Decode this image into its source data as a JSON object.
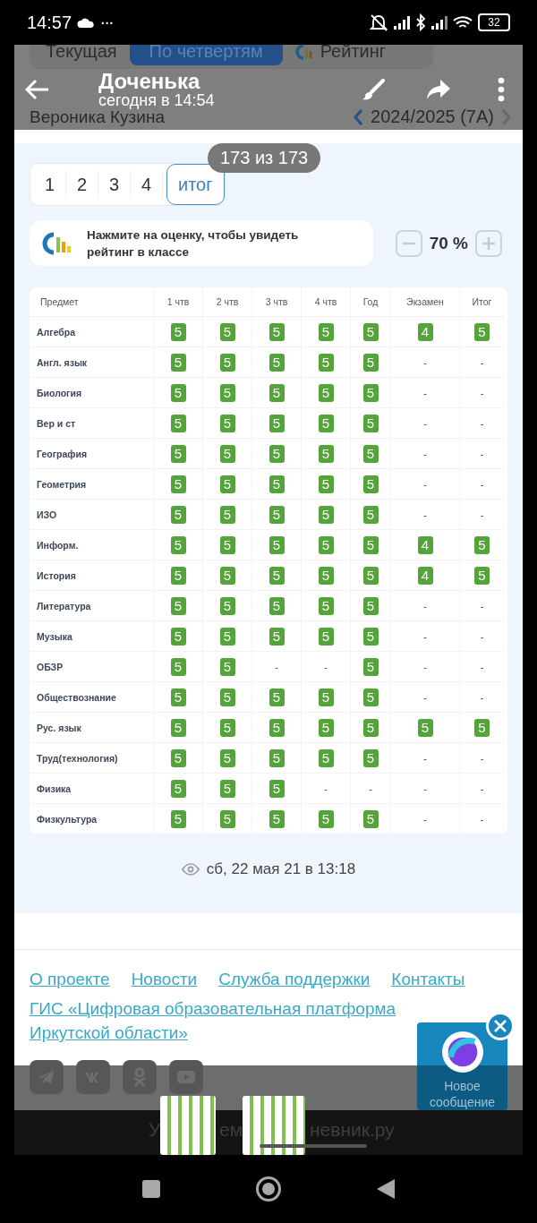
{
  "status_bar": {
    "time": "14:57",
    "more": "···",
    "battery": "32"
  },
  "page_tabs": [
    {
      "label": "Текущая",
      "selected": false
    },
    {
      "label": "По четвертям",
      "selected": true
    },
    {
      "label": "Рейтинг",
      "selected": false
    }
  ],
  "student": {
    "name": "Вероника Кузина",
    "year": "2024/2025 (7А)"
  },
  "viewer": {
    "title": "Доченька",
    "subtitle": "сегодня в 14:54",
    "counter": "173 из 173"
  },
  "quarter_tabs": [
    {
      "label": "1",
      "selected": false
    },
    {
      "label": "2",
      "selected": false
    },
    {
      "label": "3",
      "selected": false
    },
    {
      "label": "4",
      "selected": false
    },
    {
      "label": "итог",
      "selected": true
    }
  ],
  "rating_hint": {
    "text": "Нажмите на оценку, чтобы увидеть рейтинг в классе",
    "zoom": "70 %"
  },
  "table": {
    "columns": [
      "Предмет",
      "1 чтв",
      "2 чтв",
      "3 чтв",
      "4 чтв",
      "Год",
      "Экзамен",
      "Итог"
    ],
    "rows": [
      {
        "cells": [
          {
            "kind": "subject",
            "text": "Алгебра"
          },
          {
            "kind": "grade",
            "text": "5"
          },
          {
            "kind": "grade",
            "text": "5"
          },
          {
            "kind": "grade",
            "text": "5"
          },
          {
            "kind": "grade",
            "text": "5"
          },
          {
            "kind": "grade",
            "text": "5"
          },
          {
            "kind": "grade",
            "text": "4"
          },
          {
            "kind": "grade",
            "text": "5"
          }
        ]
      },
      {
        "cells": [
          {
            "kind": "subject",
            "text": "Англ. язык"
          },
          {
            "kind": "grade",
            "text": "5"
          },
          {
            "kind": "grade",
            "text": "5"
          },
          {
            "kind": "grade",
            "text": "5"
          },
          {
            "kind": "grade",
            "text": "5"
          },
          {
            "kind": "grade",
            "text": "5"
          },
          {
            "kind": "empty",
            "text": "-"
          },
          {
            "kind": "empty",
            "text": "-"
          }
        ]
      },
      {
        "cells": [
          {
            "kind": "subject",
            "text": "Биология"
          },
          {
            "kind": "grade",
            "text": "5"
          },
          {
            "kind": "grade",
            "text": "5"
          },
          {
            "kind": "grade",
            "text": "5"
          },
          {
            "kind": "grade",
            "text": "5"
          },
          {
            "kind": "grade",
            "text": "5"
          },
          {
            "kind": "empty",
            "text": "-"
          },
          {
            "kind": "empty",
            "text": "-"
          }
        ]
      },
      {
        "cells": [
          {
            "kind": "subject",
            "text": "Вер и ст"
          },
          {
            "kind": "grade",
            "text": "5"
          },
          {
            "kind": "grade",
            "text": "5"
          },
          {
            "kind": "grade",
            "text": "5"
          },
          {
            "kind": "grade",
            "text": "5"
          },
          {
            "kind": "grade",
            "text": "5"
          },
          {
            "kind": "empty",
            "text": "-"
          },
          {
            "kind": "empty",
            "text": "-"
          }
        ]
      },
      {
        "cells": [
          {
            "kind": "subject",
            "text": "География"
          },
          {
            "kind": "grade",
            "text": "5"
          },
          {
            "kind": "grade",
            "text": "5"
          },
          {
            "kind": "grade",
            "text": "5"
          },
          {
            "kind": "grade",
            "text": "5"
          },
          {
            "kind": "grade",
            "text": "5"
          },
          {
            "kind": "empty",
            "text": "-"
          },
          {
            "kind": "empty",
            "text": "-"
          }
        ]
      },
      {
        "cells": [
          {
            "kind": "subject",
            "text": "Геометрия"
          },
          {
            "kind": "grade",
            "text": "5"
          },
          {
            "kind": "grade",
            "text": "5"
          },
          {
            "kind": "grade",
            "text": "5"
          },
          {
            "kind": "grade",
            "text": "5"
          },
          {
            "kind": "grade",
            "text": "5"
          },
          {
            "kind": "empty",
            "text": "-"
          },
          {
            "kind": "empty",
            "text": "-"
          }
        ]
      },
      {
        "cells": [
          {
            "kind": "subject",
            "text": "ИЗО"
          },
          {
            "kind": "grade",
            "text": "5"
          },
          {
            "kind": "grade",
            "text": "5"
          },
          {
            "kind": "grade",
            "text": "5"
          },
          {
            "kind": "grade",
            "text": "5"
          },
          {
            "kind": "grade",
            "text": "5"
          },
          {
            "kind": "empty",
            "text": "-"
          },
          {
            "kind": "empty",
            "text": "-"
          }
        ]
      },
      {
        "cells": [
          {
            "kind": "subject",
            "text": "Информ."
          },
          {
            "kind": "grade",
            "text": "5"
          },
          {
            "kind": "grade",
            "text": "5"
          },
          {
            "kind": "grade",
            "text": "5"
          },
          {
            "kind": "grade",
            "text": "5"
          },
          {
            "kind": "grade",
            "text": "5"
          },
          {
            "kind": "grade",
            "text": "4"
          },
          {
            "kind": "grade",
            "text": "5"
          }
        ]
      },
      {
        "cells": [
          {
            "kind": "subject",
            "text": "История"
          },
          {
            "kind": "grade",
            "text": "5"
          },
          {
            "kind": "grade",
            "text": "5"
          },
          {
            "kind": "grade",
            "text": "5"
          },
          {
            "kind": "grade",
            "text": "5"
          },
          {
            "kind": "grade",
            "text": "5"
          },
          {
            "kind": "grade",
            "text": "4"
          },
          {
            "kind": "grade",
            "text": "5"
          }
        ]
      },
      {
        "cells": [
          {
            "kind": "subject",
            "text": "Литература"
          },
          {
            "kind": "grade",
            "text": "5"
          },
          {
            "kind": "grade",
            "text": "5"
          },
          {
            "kind": "grade",
            "text": "5"
          },
          {
            "kind": "grade",
            "text": "5"
          },
          {
            "kind": "grade",
            "text": "5"
          },
          {
            "kind": "empty",
            "text": "-"
          },
          {
            "kind": "empty",
            "text": "-"
          }
        ]
      },
      {
        "cells": [
          {
            "kind": "subject",
            "text": "Музыка"
          },
          {
            "kind": "grade",
            "text": "5"
          },
          {
            "kind": "grade",
            "text": "5"
          },
          {
            "kind": "grade",
            "text": "5"
          },
          {
            "kind": "grade",
            "text": "5"
          },
          {
            "kind": "grade",
            "text": "5"
          },
          {
            "kind": "empty",
            "text": "-"
          },
          {
            "kind": "empty",
            "text": "-"
          }
        ]
      },
      {
        "cells": [
          {
            "kind": "subject",
            "text": "ОБЗР"
          },
          {
            "kind": "grade",
            "text": "5"
          },
          {
            "kind": "grade",
            "text": "5"
          },
          {
            "kind": "empty",
            "text": "-"
          },
          {
            "kind": "empty",
            "text": "-"
          },
          {
            "kind": "grade",
            "text": "5"
          },
          {
            "kind": "empty",
            "text": "-"
          },
          {
            "kind": "empty",
            "text": "-"
          }
        ]
      },
      {
        "cells": [
          {
            "kind": "subject",
            "text": "Обществознание"
          },
          {
            "kind": "grade",
            "text": "5"
          },
          {
            "kind": "grade",
            "text": "5"
          },
          {
            "kind": "grade",
            "text": "5"
          },
          {
            "kind": "grade",
            "text": "5"
          },
          {
            "kind": "grade",
            "text": "5"
          },
          {
            "kind": "empty",
            "text": "-"
          },
          {
            "kind": "empty",
            "text": "-"
          }
        ]
      },
      {
        "cells": [
          {
            "kind": "subject",
            "text": "Рус. язык"
          },
          {
            "kind": "grade",
            "text": "5"
          },
          {
            "kind": "grade",
            "text": "5"
          },
          {
            "kind": "grade",
            "text": "5"
          },
          {
            "kind": "grade",
            "text": "5"
          },
          {
            "kind": "grade",
            "text": "5"
          },
          {
            "kind": "grade",
            "text": "5"
          },
          {
            "kind": "grade",
            "text": "5"
          }
        ]
      },
      {
        "cells": [
          {
            "kind": "subject",
            "text": "Труд(технология)"
          },
          {
            "kind": "grade",
            "text": "5"
          },
          {
            "kind": "grade",
            "text": "5"
          },
          {
            "kind": "grade",
            "text": "5"
          },
          {
            "kind": "grade",
            "text": "5"
          },
          {
            "kind": "grade",
            "text": "5"
          },
          {
            "kind": "empty",
            "text": "-"
          },
          {
            "kind": "empty",
            "text": "-"
          }
        ]
      },
      {
        "cells": [
          {
            "kind": "subject",
            "text": "Физика"
          },
          {
            "kind": "grade",
            "text": "5"
          },
          {
            "kind": "grade",
            "text": "5"
          },
          {
            "kind": "grade",
            "text": "5"
          },
          {
            "kind": "empty",
            "text": "-"
          },
          {
            "kind": "empty",
            "text": "-"
          },
          {
            "kind": "empty",
            "text": "-"
          },
          {
            "kind": "empty",
            "text": "-"
          }
        ]
      },
      {
        "cells": [
          {
            "kind": "subject",
            "text": "Физкультура"
          },
          {
            "kind": "grade",
            "text": "5"
          },
          {
            "kind": "grade",
            "text": "5"
          },
          {
            "kind": "grade",
            "text": "5"
          },
          {
            "kind": "grade",
            "text": "5"
          },
          {
            "kind": "grade",
            "text": "5"
          },
          {
            "kind": "empty",
            "text": "-"
          },
          {
            "kind": "empty",
            "text": "-"
          }
        ]
      }
    ]
  },
  "viewed": "сб, 22 мая 21 в 13:18",
  "footer_links": [
    "О проекте",
    "Новости",
    "Служба поддержки",
    "Контакты"
  ],
  "footer_platform": "ГИС «Цифровая образовательная платформа Иркутской области»",
  "chat_widget": {
    "label": "Новое сообщение"
  },
  "bottom_text": [
    "У",
    "ем",
    "невник.ру"
  ]
}
